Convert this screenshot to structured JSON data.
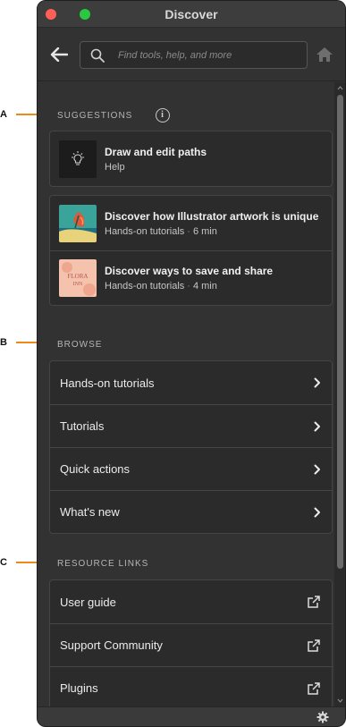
{
  "callouts": [
    "A",
    "B",
    "C"
  ],
  "window": {
    "title": "Discover"
  },
  "search": {
    "placeholder": "Find tools, help, and more"
  },
  "suggestions": {
    "heading": "SUGGESTIONS",
    "info_glyph": "i",
    "top_item": {
      "title": "Draw and edit paths",
      "subtitle": "Help"
    },
    "tutorials": [
      {
        "title": "Discover how Illustrator artwork is unique",
        "category": "Hands-on tutorials",
        "duration": "6 min"
      },
      {
        "title": "Discover ways to save and share",
        "category": "Hands-on tutorials",
        "duration": "4 min",
        "thumb_text_1": "FLORA",
        "thumb_text_2": "INN"
      }
    ],
    "separator": "·"
  },
  "browse": {
    "heading": "BROWSE",
    "items": [
      "Hands-on tutorials",
      "Tutorials",
      "Quick actions",
      "What's new"
    ]
  },
  "resources": {
    "heading": "RESOURCE LINKS",
    "items": [
      "User guide",
      "Support Community",
      "Plugins"
    ]
  },
  "icons": {
    "back": "arrow-left-icon",
    "search": "search-icon",
    "home": "home-icon",
    "bulb": "lightbulb-icon",
    "chevron": "chevron-right-icon",
    "external": "external-link-icon",
    "settings": "gear-icon"
  },
  "colors": {
    "accent": "#ef8a19",
    "panel_bg": "#323232",
    "card_bg": "#2b2b2b",
    "border": "#454545"
  }
}
